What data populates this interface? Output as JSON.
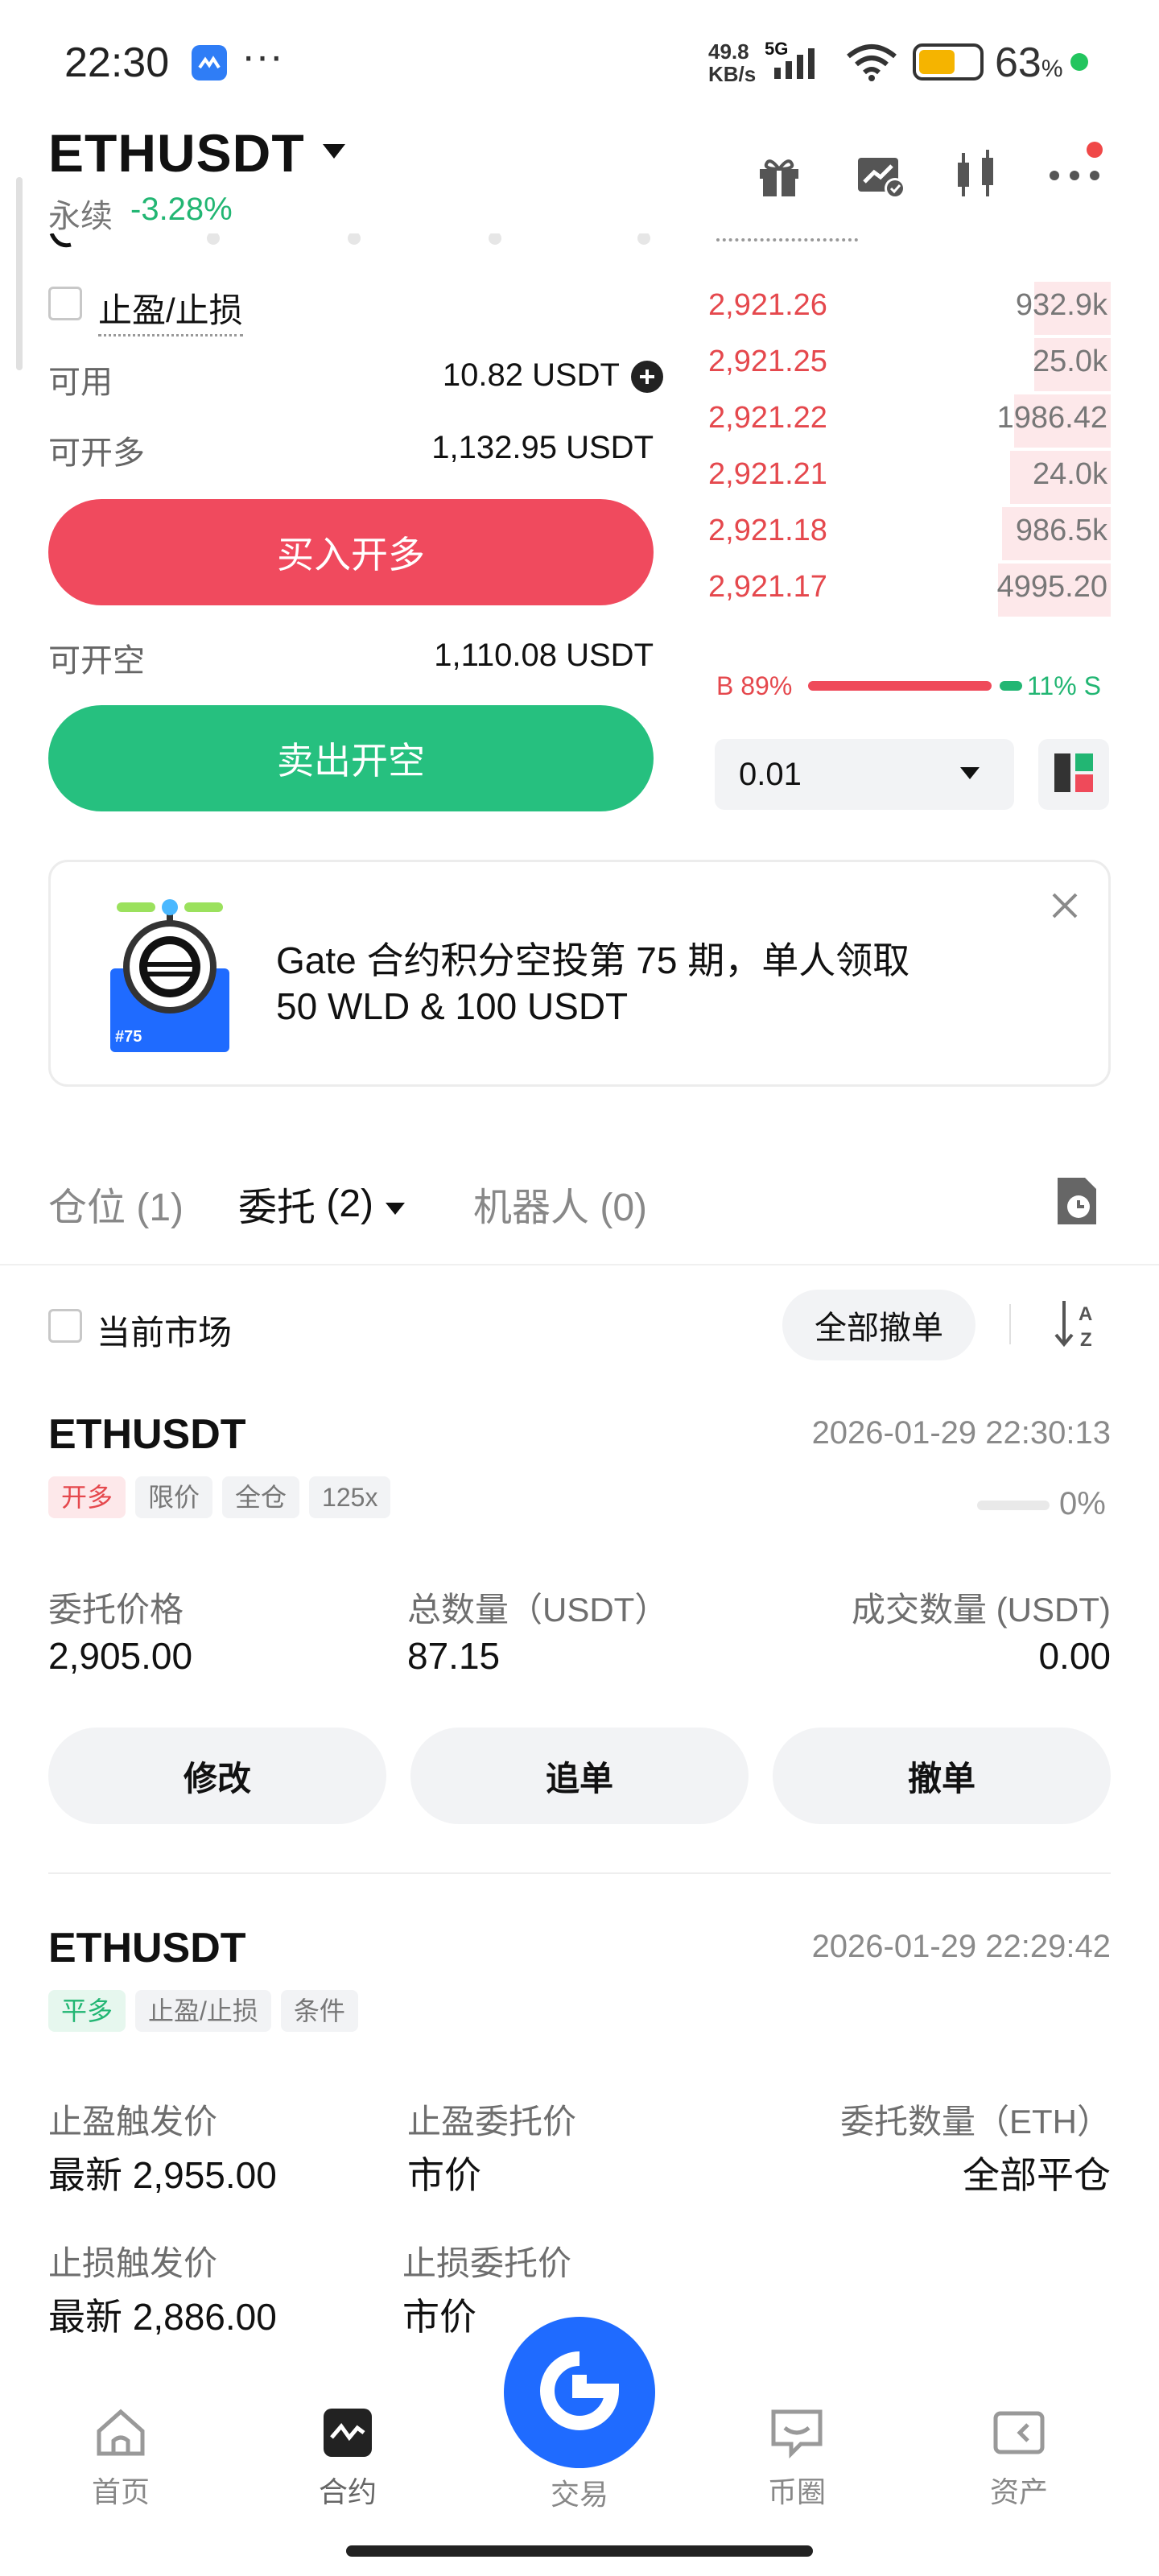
{
  "status_bar": {
    "time": "22:30",
    "dots": "···",
    "net_speed_top": "49.8",
    "net_speed_bottom": "KB/s",
    "net_type": "5G",
    "battery": "63",
    "battery_unit": "%"
  },
  "header": {
    "symbol": "ETHUSDT",
    "contract_type": "永续",
    "change": "-3.28%"
  },
  "order_form": {
    "tp_sl_label": "止盈/止损",
    "available_label": "可用",
    "available_value": "10.82 USDT",
    "can_long_label": "可开多",
    "can_long_value": "1,132.95 USDT",
    "buy_button": "买入开多",
    "can_short_label": "可开空",
    "can_short_value": "1,110.08 USDT",
    "sell_button": "卖出开空"
  },
  "orderbook": {
    "asks": [
      {
        "price": "2,921.26",
        "qty": "932.9k",
        "depth": 0.19
      },
      {
        "price": "2,921.25",
        "qty": "25.0k",
        "depth": 0.19
      },
      {
        "price": "2,921.22",
        "qty": "1986.42",
        "depth": 0.24
      },
      {
        "price": "2,921.21",
        "qty": "24.0k",
        "depth": 0.25
      },
      {
        "price": "2,921.18",
        "qty": "986.5k",
        "depth": 0.27
      },
      {
        "price": "2,921.17",
        "qty": "4995.20",
        "depth": 0.28
      }
    ],
    "buy_ratio_label": "B 89%",
    "sell_ratio_label": "11% S",
    "buy_ratio": 0.89,
    "precision": "0.01"
  },
  "banner": {
    "line1": "Gate 合约积分空投第 75 期，单人领取",
    "line2": "50 WLD & 100 USDT",
    "badge": "#75"
  },
  "tabs": {
    "positions": "仓位",
    "positions_count": "(1)",
    "orders": "委托",
    "orders_count": "(2)",
    "bots": "机器人",
    "bots_count": "(0)"
  },
  "filter": {
    "current_market": "当前市场",
    "cancel_all": "全部撤单"
  },
  "order1": {
    "symbol": "ETHUSDT",
    "time": "2026-01-29 22:30:13",
    "tags": [
      "开多",
      "限价",
      "全仓",
      "125x"
    ],
    "progress": "0%",
    "price_label": "委托价格",
    "price": "2,905.00",
    "total_label": "总数量（USDT）",
    "total": "87.15",
    "filled_label": "成交数量 (USDT)",
    "filled": "0.00",
    "btn_modify": "修改",
    "btn_chase": "追单",
    "btn_cancel": "撤单"
  },
  "order2": {
    "symbol": "ETHUSDT",
    "time": "2026-01-29 22:29:42",
    "tags": [
      "平多",
      "止盈/止损",
      "条件"
    ],
    "tp_trigger_label": "止盈触发价",
    "tp_trigger": "最新 2,955.00",
    "tp_order_label": "止盈委托价",
    "tp_order": "市价",
    "qty_label": "委托数量（ETH）",
    "qty": "全部平仓",
    "sl_trigger_label": "止损触发价",
    "sl_trigger": "最新 2,886.00",
    "sl_order_label": "止损委托价",
    "sl_order": "市价"
  },
  "bottom_nav": {
    "home": "首页",
    "futures": "合约",
    "trade": "交易",
    "square": "币圈",
    "assets": "资产"
  },
  "colors": {
    "red": "#e5484d",
    "green": "#22b673",
    "blue": "#1f6bff"
  }
}
